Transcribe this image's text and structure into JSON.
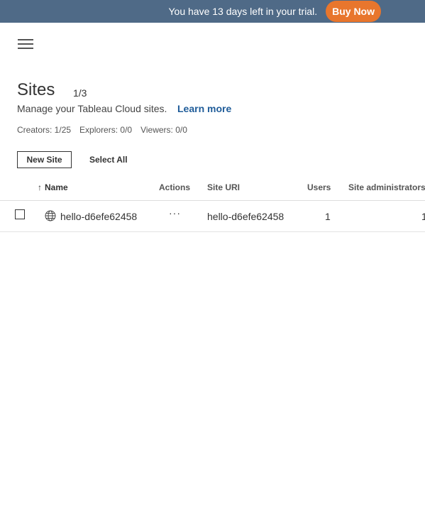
{
  "banner": {
    "trial_text": "You have 13 days left in your trial.",
    "buy_now_label": "Buy Now",
    "background_color": "#4f6a87",
    "button_color": "#e8762d"
  },
  "header": {
    "menu_icon": "hamburger-icon",
    "title": "Sites",
    "count": "1/3",
    "subtitle": "Manage your Tableau Cloud sites.",
    "learn_more": "Learn more",
    "link_color": "#1f5c99"
  },
  "licenses": {
    "creators": "Creators: 1/25",
    "explorers": "Explorers: 0/0",
    "viewers": "Viewers: 0/0"
  },
  "toolbar": {
    "new_site_label": "New Site",
    "select_all_label": "Select All"
  },
  "table": {
    "sort_icon": "↑",
    "columns": {
      "name": "Name",
      "actions": "Actions",
      "site_uri": "Site URI",
      "users": "Users",
      "site_admins": "Site administrators"
    },
    "rows": [
      {
        "name": "hello-d6efe62458",
        "actions": "···",
        "site_uri": "hello-d6efe62458",
        "users": "1",
        "site_admins": "1",
        "icon": "globe-icon"
      }
    ]
  }
}
